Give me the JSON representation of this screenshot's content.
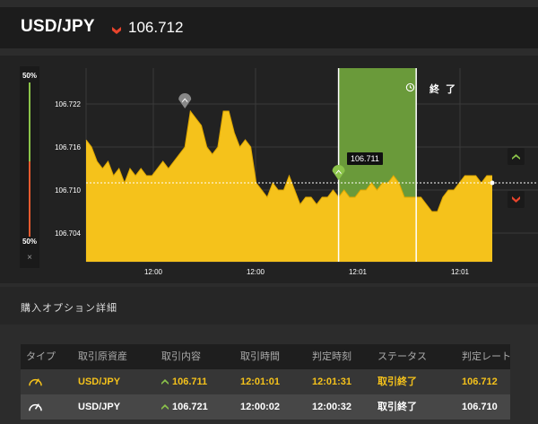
{
  "header": {
    "pair": "USD/JPY",
    "price": "106.712",
    "trend_icon": "chevron-down-red-icon",
    "trend_color": "#e8442c"
  },
  "gauge": {
    "top_label": "50%",
    "bottom_label": "50%",
    "close": "×",
    "up_color": "#8bc34a",
    "down_color": "#e55a2e"
  },
  "chart": {
    "y_ticks": [
      "106.722",
      "106.716",
      "106.710",
      "106.704"
    ],
    "x_ticks": [
      "12:00",
      "12:00",
      "12:01",
      "12:01"
    ],
    "current_price_tag": "106.711",
    "end_label": "終 了",
    "fill_color": "#f5c21b",
    "zone_color": "#6a9a3a"
  },
  "chart_data": {
    "type": "area",
    "title": "",
    "xlabel": "",
    "ylabel": "",
    "ylim": [
      106.7,
      106.727
    ],
    "x_tick_labels": [
      "12:00",
      "12:00",
      "12:01",
      "12:01"
    ],
    "y_tick_labels": [
      "106.722",
      "106.716",
      "106.710",
      "106.704"
    ],
    "series": [
      {
        "values": [
          106.717,
          106.716,
          106.714,
          106.713,
          106.714,
          106.712,
          106.713,
          106.711,
          106.713,
          106.712,
          106.713,
          106.712,
          106.712,
          106.713,
          106.714,
          106.713,
          106.714,
          106.715,
          106.716,
          106.721,
          106.72,
          106.719,
          106.716,
          106.715,
          106.716,
          106.721,
          106.721,
          106.718,
          106.716,
          106.717,
          106.716,
          106.711,
          106.71,
          106.709,
          106.711,
          106.71,
          106.71,
          106.712,
          106.71,
          106.708,
          106.709,
          106.709,
          106.708,
          106.709,
          106.709,
          106.71,
          106.709,
          106.71,
          106.709,
          106.709,
          106.71,
          106.71,
          106.711,
          106.71,
          106.711,
          106.711,
          106.712,
          106.711,
          106.709,
          106.709,
          106.709,
          106.709,
          106.708,
          106.707,
          106.707,
          106.709,
          106.71,
          106.71,
          106.711,
          106.712,
          106.712,
          106.712,
          106.711,
          106.712,
          106.712
        ]
      }
    ],
    "reference_line": 106.711,
    "markers": [
      {
        "index": 18,
        "value": 106.721,
        "color": "#888888"
      },
      {
        "index": 46,
        "value": 106.711,
        "color": "#8bc34a"
      }
    ],
    "shaded_zone": {
      "from_index": 46,
      "to_index": 59
    }
  },
  "section": {
    "title": "購入オプション詳細"
  },
  "table": {
    "headers": [
      "タイプ",
      "取引原資産",
      "取引内容",
      "取引時間",
      "判定時刻",
      "ステータス",
      "判定レート"
    ],
    "rows": [
      {
        "asset": "USD/JPY",
        "content": "106.711",
        "time": "12:01:01",
        "judge": "12:01:31",
        "status": "取引終了",
        "rate": "106.712",
        "type_icon": "speedometer-icon"
      },
      {
        "asset": "USD/JPY",
        "content": "106.721",
        "time": "12:00:02",
        "judge": "12:00:32",
        "status": "取引終了",
        "rate": "106.710",
        "type_icon": "speedometer-icon"
      }
    ]
  }
}
